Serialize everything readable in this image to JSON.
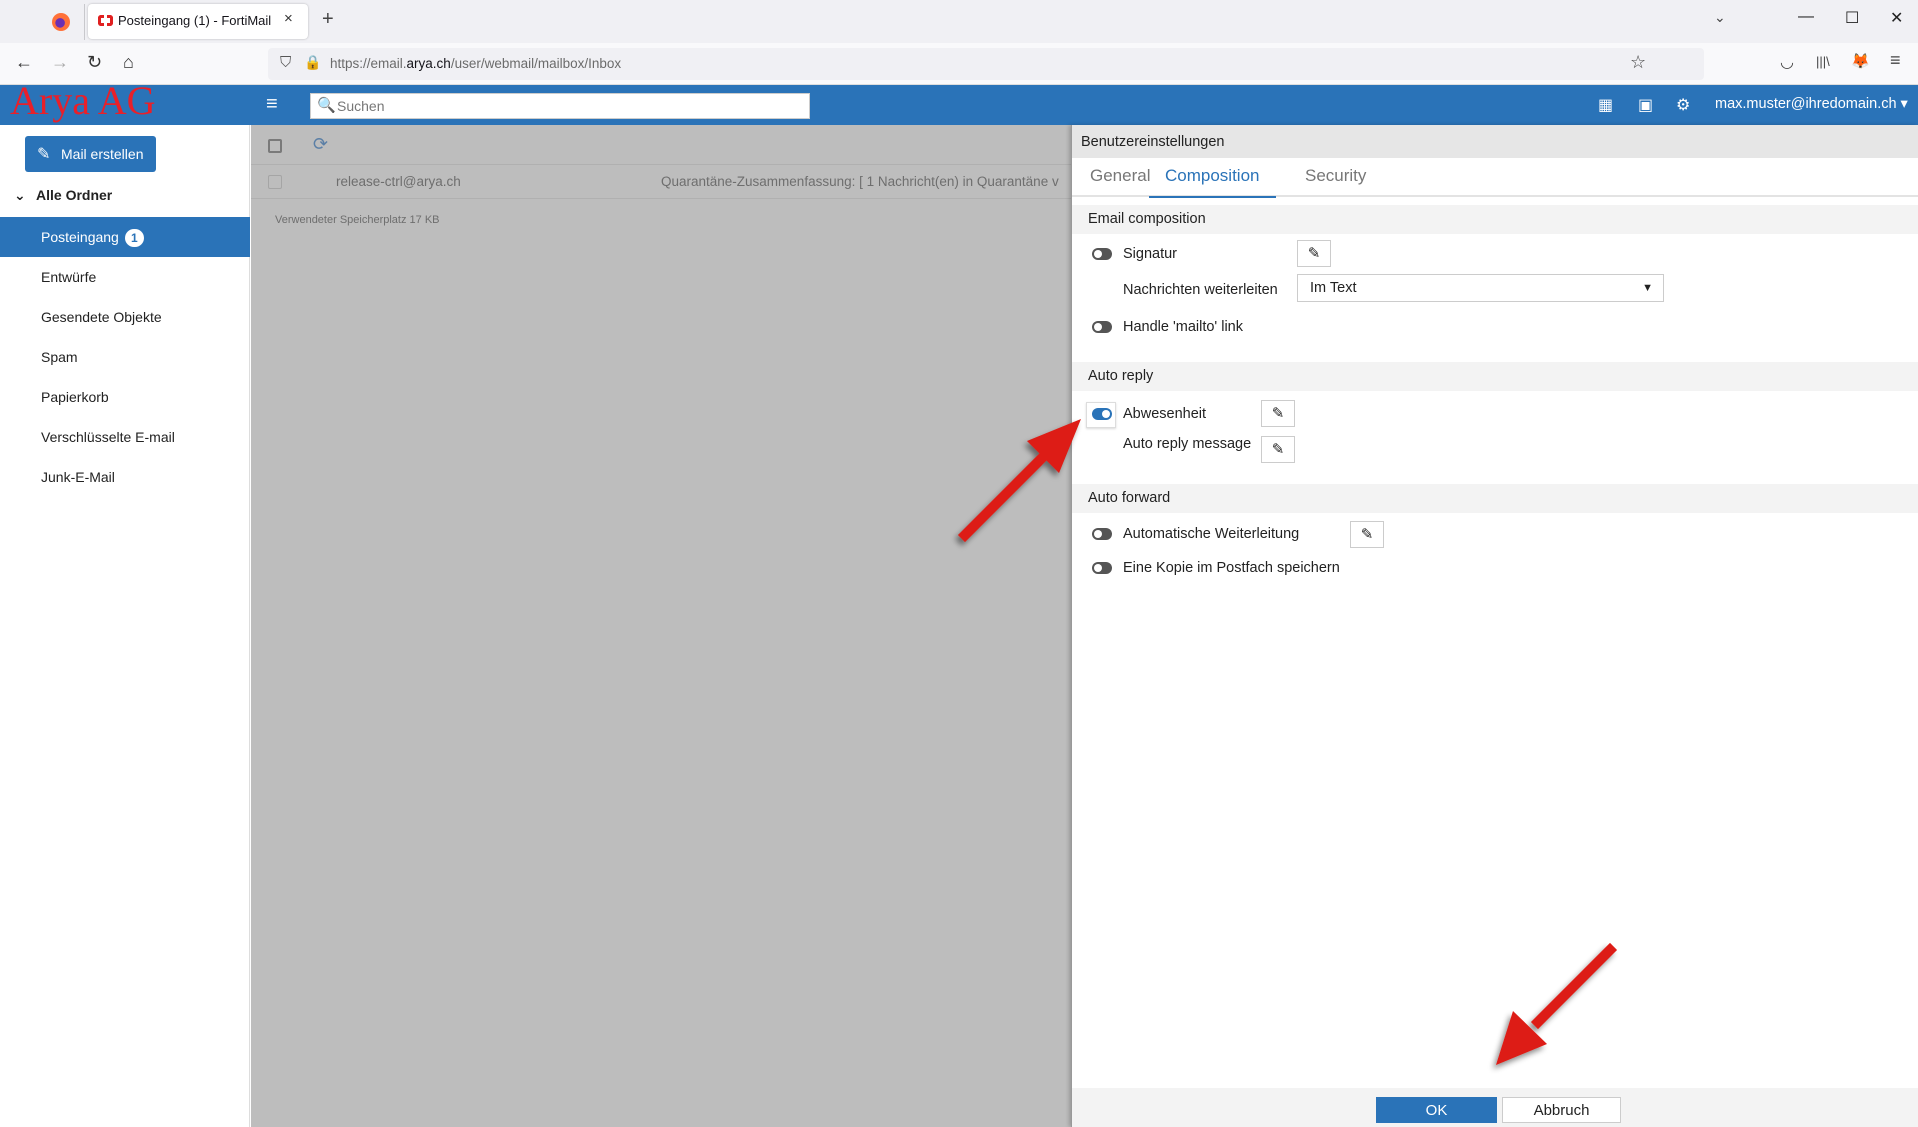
{
  "browser": {
    "tab_title": "Posteingang (1) - FortiMail",
    "tab_close": "×",
    "new_tab": "+",
    "tab_list": "⌄",
    "window_controls": {
      "minimize": "—",
      "maximize": "☐",
      "close": "✕"
    },
    "nav": {
      "back": "←",
      "forward": "→",
      "reload": "↻",
      "home": "⌂"
    },
    "url_prefix": "https://email.",
    "url_domain": "arya.ch",
    "url_path": "/user/webmail/mailbox/Inbox",
    "icons": {
      "shield": "⛉",
      "lock": "🔒",
      "star": "☆",
      "pocket": "◡",
      "library": "|||\\",
      "extension": "🦊",
      "menu": "≡"
    }
  },
  "header": {
    "logo": "Arya AG",
    "menu_icon": "≡",
    "search_placeholder": "Suchen",
    "search_icon": "🔍",
    "calendar_icon": "▦",
    "contacts_icon": "▣",
    "settings_icon": "⚙",
    "user": "max.muster@ihredomain.ch ▾"
  },
  "sidebar": {
    "compose_label": "Mail erstellen",
    "compose_icon": "✎",
    "folders_header": "Alle Ordner",
    "folders_chevron": "⌄",
    "folders": [
      {
        "label": "Posteingang",
        "badge": "1",
        "active": true
      },
      {
        "label": "Entwürfe"
      },
      {
        "label": "Gesendete Objekte"
      },
      {
        "label": "Spam"
      },
      {
        "label": "Papierkorb"
      },
      {
        "label": "Verschlüsselte E-mail"
      },
      {
        "label": "Junk-E-Mail"
      }
    ]
  },
  "maillist": {
    "refresh_icon": "⟳",
    "messages": [
      {
        "sender": "release-ctrl@arya.ch",
        "subject": "Quarantäne-Zusammenfassung: [ 1 Nachricht(en) in Quarantäne v"
      }
    ],
    "storage": "Verwendeter Speicherplatz 17 KB"
  },
  "settings": {
    "title": "Benutzereinstellungen",
    "tabs": [
      {
        "label": "General"
      },
      {
        "label": "Composition",
        "active": true
      },
      {
        "label": "Security"
      }
    ],
    "sections": {
      "composition": {
        "title": "Email composition",
        "signature_label": "Signatur",
        "signature_enabled": false,
        "forward_label": "Nachrichten weiterleiten",
        "forward_value": "Im Text",
        "mailto_label": "Handle 'mailto' link",
        "mailto_enabled": false
      },
      "auto_reply": {
        "title": "Auto reply",
        "away_label": "Abwesenheit",
        "away_enabled": true,
        "message_label": "Auto reply message"
      },
      "auto_forward": {
        "title": "Auto forward",
        "forward_label": "Automatische Weiterleitung",
        "forward_enabled": false,
        "copy_label": "Eine Kopie im Postfach speichern",
        "copy_enabled": false
      }
    },
    "edit_icon": "✎",
    "select_caret": "▼",
    "ok_label": "OK",
    "cancel_label": "Abbruch"
  },
  "annotations": {
    "arrow_color": "#dd1a12"
  }
}
